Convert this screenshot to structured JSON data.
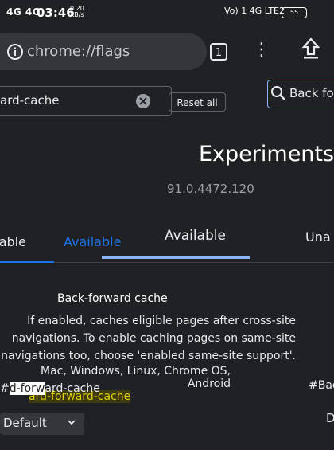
{
  "status_bar": {
    "signal": "4G 4G",
    "time": "03:46",
    "speed": "0.20 KB/s",
    "right": "Vo) 1 4G LTE2",
    "battery": "55"
  },
  "omnibox": {
    "url": "chrome://flags",
    "tab_count": "1"
  },
  "search": {
    "value": "ard-cache",
    "reset_label": "Reset all",
    "search2_value": "Back fo"
  },
  "page": {
    "title": "Experiments",
    "version": "91.0.4472.120"
  },
  "tabs": {
    "available_left": "ailable",
    "available_ghost": "Available",
    "available": "Available",
    "unavailable": "Una"
  },
  "experiment": {
    "name": "Back-forward cache",
    "description": "If enabled, caches eligible pages after cross-site navigations. To enable caching pages on same-site navigations too, choose 'enabled same-site support'.",
    "platforms": "Mac, Windows, Linux, Chrome OS, Android",
    "hash_prefix": "#",
    "hash_highlight": "d-forw",
    "hash_rest": "ard-cache",
    "hash_ghost": "ard-forward-cache",
    "hash_right": "#Bac",
    "select_value": "Default",
    "select_value_right": "D"
  },
  "colors": {
    "background": "#202124",
    "accent": "#8ab4f8",
    "link": "#1a73e8"
  },
  "icons": [
    "info-icon",
    "tab-switcher-icon",
    "more-vert-icon",
    "update-icon",
    "clear-icon",
    "search-icon",
    "chevron-down-icon"
  ]
}
